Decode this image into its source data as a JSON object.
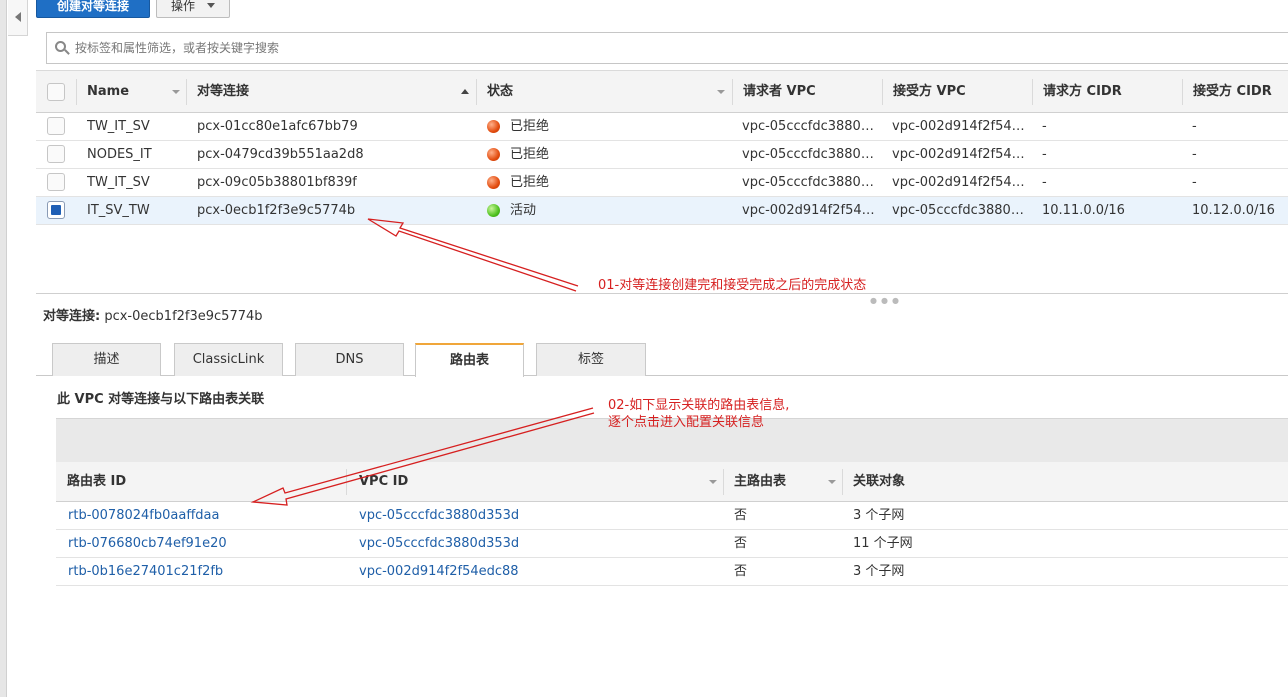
{
  "toolbar": {
    "create_label": "创建对等连接",
    "actions_label": "操作"
  },
  "search": {
    "placeholder": "按标签和属性筛选，或者按关键字搜索"
  },
  "connections_table": {
    "columns": [
      "Name",
      "对等连接",
      "状态",
      "请求者 VPC",
      "接受方 VPC",
      "请求方 CIDR",
      "接受方 CIDR"
    ],
    "rows": [
      {
        "name": "TW_IT_SV",
        "peering_id": "pcx-01cc80e1afc67bb79",
        "status": "已拒绝",
        "status_color": "red",
        "requester_vpc": "vpc-05cccfdc3880…",
        "accepter_vpc": "vpc-002d914f2f54…",
        "requester_cidr": "-",
        "accepter_cidr": "-",
        "selected": false
      },
      {
        "name": "NODES_IT",
        "peering_id": "pcx-0479cd39b551aa2d8",
        "status": "已拒绝",
        "status_color": "red",
        "requester_vpc": "vpc-05cccfdc3880…",
        "accepter_vpc": "vpc-002d914f2f54…",
        "requester_cidr": "-",
        "accepter_cidr": "-",
        "selected": false
      },
      {
        "name": "TW_IT_SV",
        "peering_id": "pcx-09c05b38801bf839f",
        "status": "已拒绝",
        "status_color": "red",
        "requester_vpc": "vpc-05cccfdc3880…",
        "accepter_vpc": "vpc-002d914f2f54…",
        "requester_cidr": "-",
        "accepter_cidr": "-",
        "selected": false
      },
      {
        "name": "IT_SV_TW",
        "peering_id": "pcx-0ecb1f2f3e9c5774b",
        "status": "活动",
        "status_color": "green",
        "requester_vpc": "vpc-002d914f2f54…",
        "accepter_vpc": "vpc-05cccfdc3880…",
        "requester_cidr": "10.11.0.0/16",
        "accepter_cidr": "10.12.0.0/16",
        "selected": true
      }
    ]
  },
  "detail": {
    "label": "对等连接:",
    "value": "pcx-0ecb1f2f3e9c5774b",
    "tabs": [
      "描述",
      "ClassicLink",
      "DNS",
      "路由表",
      "标签"
    ],
    "active_tab": "路由表",
    "section_title": "此 VPC 对等连接与以下路由表关联"
  },
  "route_tables": {
    "columns": [
      "路由表 ID",
      "VPC ID",
      "主路由表",
      "关联对象"
    ],
    "rows": [
      {
        "id": "rtb-0078024fb0aaffdaa",
        "vpc": "vpc-05cccfdc3880d353d",
        "main": "否",
        "assoc": "3 个子网"
      },
      {
        "id": "rtb-076680cb74ef91e20",
        "vpc": "vpc-05cccfdc3880d353d",
        "main": "否",
        "assoc": "11 个子网"
      },
      {
        "id": "rtb-0b16e27401c21f2fb",
        "vpc": "vpc-002d914f2f54edc88",
        "main": "否",
        "assoc": "3 个子网"
      }
    ]
  },
  "annotations": {
    "note1": "01-对等连接创建完和接受完成之后的完成状态",
    "note2_line1": "02-如下显示关联的路由表信息,",
    "note2_line2": "逐个点击进入配置关联信息",
    "color": "#d62020"
  },
  "colors": {
    "primary_button": "#1f6fc5",
    "link": "#1f5fa8",
    "active_tab_accent": "#f0a63a",
    "selected_row": "#eaf3fc"
  },
  "icons": [
    "search-icon",
    "collapse-arrow-icon",
    "caret-down-icon",
    "status-dot-icon"
  ]
}
